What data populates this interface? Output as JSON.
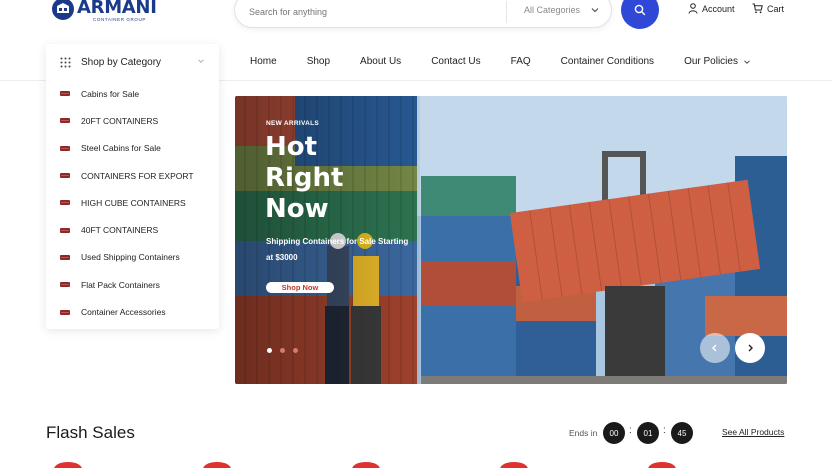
{
  "header": {
    "logo": {
      "name": "ARMANI",
      "tagline": "CONTAINER GROUP"
    },
    "search": {
      "placeholder": "Search for anything",
      "category": "All Categories"
    },
    "account_label": "Account",
    "cart_label": "Cart"
  },
  "categories": {
    "heading": "Shop by Category",
    "items": [
      "Cabins for Sale",
      "20FT CONTAINERS",
      "Steel Cabins for Sale",
      "CONTAINERS FOR EXPORT",
      "HIGH CUBE CONTAINERS",
      "40FT CONTAINERS",
      "Used Shipping Containers",
      "Flat Pack Containers",
      "Container Accessories"
    ]
  },
  "nav": {
    "items": [
      "Home",
      "Shop",
      "About Us",
      "Contact Us",
      "FAQ",
      "Container Conditions",
      "Our Policies"
    ]
  },
  "hero": {
    "tag": "NEW ARRIVALS",
    "title": "Hot Right Now",
    "description": "Shipping Containers for Sale Starting at $3000",
    "button": "Shop Now",
    "active_slide": 1,
    "slide_count": 3
  },
  "flash": {
    "title": "Flash Sales",
    "ends_in_label": "Ends in",
    "timer": {
      "hours": "00",
      "minutes": "01",
      "seconds": "45"
    },
    "see_all": "See All Products"
  },
  "colors": {
    "brand": "#1b3a8a",
    "accent": "#2f48d6",
    "sale_red": "#e03131"
  }
}
